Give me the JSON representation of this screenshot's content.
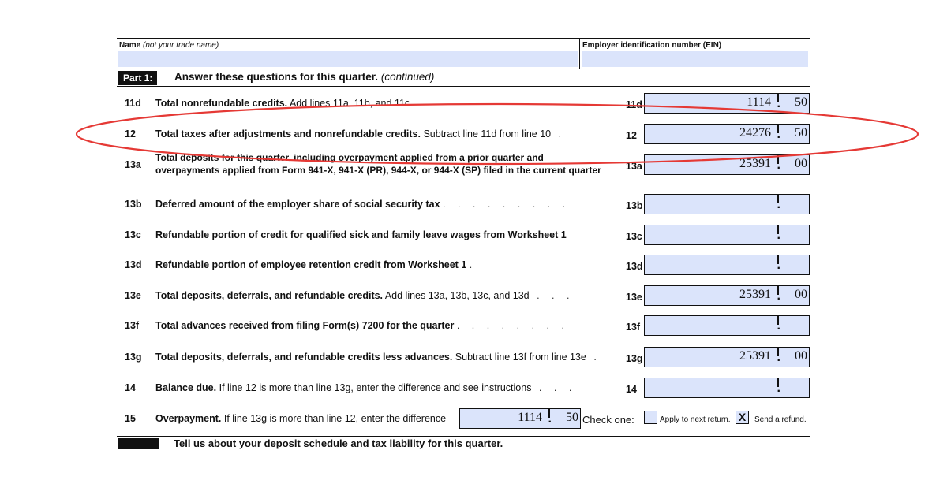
{
  "header": {
    "top_cut_text": "",
    "name_label": "Name",
    "name_note": "(not your trade name)",
    "ein_label": "Employer identification number (EIN)"
  },
  "part1": {
    "tag": "Part 1:",
    "title": "Answer these questions for this quarter.",
    "title_note": "(continued)"
  },
  "lines": [
    {
      "num": "11d",
      "bold": "Total nonrefundable credits.",
      "rest": "Add lines 11a, 11b, and 11c",
      "dots": "",
      "ref": "11d",
      "whole": "1114",
      "cents": "50"
    },
    {
      "num": "12",
      "bold": "Total taxes after adjustments and nonrefundable credits.",
      "rest": "Subtract line 11d from line 10",
      "dots": " .",
      "ref": "12",
      "whole": "24276",
      "cents": "50"
    },
    {
      "num": "13a",
      "line1": "Total deposits for this quarter, including overpayment applied from a prior quarter and",
      "line2": "overpayments applied from Form 941-X, 941-X (PR), 944-X, or 944-X (SP) filed in the current quarter",
      "ref": "13a",
      "whole": "25391",
      "cents": "00"
    },
    {
      "num": "13b",
      "bold": "Deferred amount of the employer share of social security tax",
      "rest": "",
      "dots": " . . . . . . . . .",
      "ref": "13b",
      "whole": "",
      "cents": ""
    },
    {
      "num": "13c",
      "bold": "Refundable portion of credit for qualified sick and family leave wages from Worksheet 1",
      "rest": "",
      "dots": "",
      "ref": "13c",
      "whole": "",
      "cents": ""
    },
    {
      "num": "13d",
      "bold": "Refundable portion of employee retention credit from Worksheet 1",
      "rest": "",
      "dots": " .",
      "ref": "13d",
      "whole": "",
      "cents": ""
    },
    {
      "num": "13e",
      "bold": "Total deposits, deferrals, and refundable credits.",
      "rest": "Add lines 13a, 13b, 13c, and 13d",
      "dots": " . . .",
      "ref": "13e",
      "whole": "25391",
      "cents": "00"
    },
    {
      "num": "13f",
      "bold": "Total advances received from filing Form(s) 7200 for the quarter",
      "rest": "",
      "dots": " . . . . . . . .",
      "ref": "13f",
      "whole": "",
      "cents": ""
    },
    {
      "num": "13g",
      "bold": "Total deposits, deferrals, and refundable credits less advances.",
      "rest": "Subtract line 13f from line 13e",
      "dots": " .",
      "ref": "13g",
      "whole": "25391",
      "cents": "00"
    },
    {
      "num": "14",
      "bold": "Balance due.",
      "rest": "If line 12 is more than line 13g, enter the difference and see instructions",
      "dots": " . . .",
      "ref": "14",
      "whole": "",
      "cents": ""
    }
  ],
  "line15": {
    "num": "15",
    "bold": "Overpayment.",
    "rest": "If line 13g is more than line 12, enter the difference",
    "whole": "1114",
    "cents": "50",
    "check_label": "Check one:",
    "opt1_label": "Apply to next return.",
    "opt1_mark": "",
    "opt2_label": "Send a refund.",
    "opt2_mark": "X"
  },
  "part2_cut_text": "Tell us about your deposit schedule and tax liability for this quarter.",
  "colors": {
    "field_fill": "#dbe4fb",
    "highlight": "#e53935"
  }
}
